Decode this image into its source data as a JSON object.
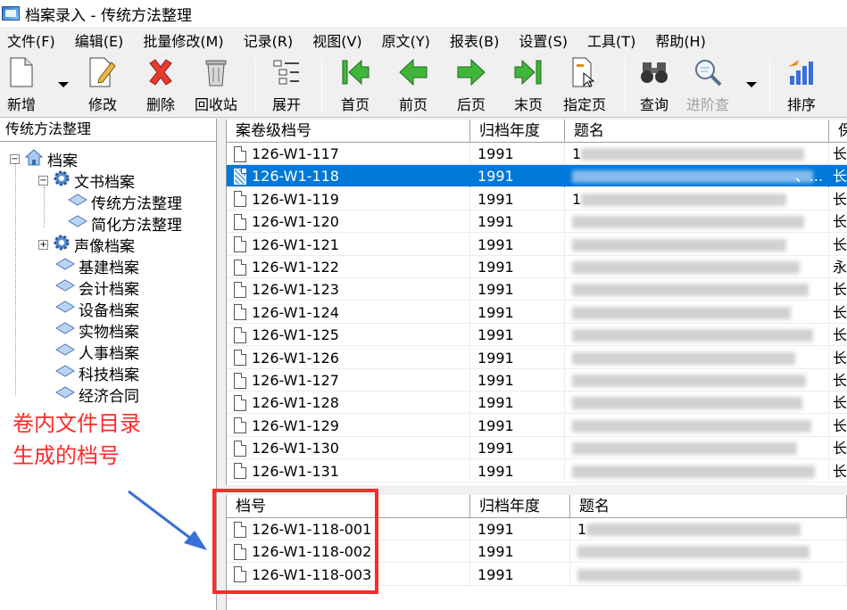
{
  "window": {
    "title": "档案录入 - 传统方法整理"
  },
  "menu": [
    "文件(F)",
    "编辑(E)",
    "批量修改(M)",
    "记录(R)",
    "视图(V)",
    "原文(Y)",
    "报表(B)",
    "设置(S)",
    "工具(T)",
    "帮助(H)"
  ],
  "toolbar": {
    "new": "新增",
    "edit": "修改",
    "delete": "删除",
    "recycle": "回收站",
    "expand": "展开",
    "first": "首页",
    "prev": "前页",
    "next": "后页",
    "last": "末页",
    "goto": "指定页",
    "query": "查询",
    "advanced_query": "进阶查",
    "sort": "排序"
  },
  "tree": {
    "header": "传统方法整理",
    "root": "档案",
    "items": [
      {
        "label": "文书档案"
      },
      {
        "label": "传统方法整理"
      },
      {
        "label": "简化方法整理"
      },
      {
        "label": "声像档案"
      },
      {
        "label": "基建档案"
      },
      {
        "label": "会计档案"
      },
      {
        "label": "设备档案"
      },
      {
        "label": "实物档案"
      },
      {
        "label": "人事档案"
      },
      {
        "label": "科技档案"
      },
      {
        "label": "经济合同"
      }
    ]
  },
  "annotation": {
    "line1": "卷内文件目录",
    "line2": "生成的档号"
  },
  "upper_grid": {
    "columns": [
      "案卷级档号",
      "归档年度",
      "题名",
      "保"
    ],
    "rows": [
      {
        "code": "126-W1-117",
        "year": "1991",
        "title_prefix": "1",
        "retention": "长"
      },
      {
        "code": "126-W1-118",
        "year": "1991",
        "title_prefix": "",
        "title_suffix": "、...",
        "retention": "长"
      },
      {
        "code": "126-W1-119",
        "year": "1991",
        "title_prefix": "1",
        "retention": "长"
      },
      {
        "code": "126-W1-120",
        "year": "1991",
        "title_prefix": "",
        "retention": "长"
      },
      {
        "code": "126-W1-121",
        "year": "1991",
        "title_prefix": "",
        "retention": "长"
      },
      {
        "code": "126-W1-122",
        "year": "1991",
        "title_prefix": "",
        "retention": "永"
      },
      {
        "code": "126-W1-123",
        "year": "1991",
        "title_prefix": "",
        "retention": "长"
      },
      {
        "code": "126-W1-124",
        "year": "1991",
        "title_prefix": "",
        "retention": "长"
      },
      {
        "code": "126-W1-125",
        "year": "1991",
        "title_prefix": "",
        "retention": "长"
      },
      {
        "code": "126-W1-126",
        "year": "1991",
        "title_prefix": "",
        "retention": "长"
      },
      {
        "code": "126-W1-127",
        "year": "1991",
        "title_prefix": "",
        "retention": "长"
      },
      {
        "code": "126-W1-128",
        "year": "1991",
        "title_prefix": "",
        "retention": "长"
      },
      {
        "code": "126-W1-129",
        "year": "1991",
        "title_prefix": "",
        "retention": "长"
      },
      {
        "code": "126-W1-130",
        "year": "1991",
        "title_prefix": "",
        "retention": "长"
      },
      {
        "code": "126-W1-131",
        "year": "1991",
        "title_prefix": "",
        "retention": "长"
      }
    ]
  },
  "lower_grid": {
    "columns": [
      "档号",
      "归档年度",
      "题名"
    ],
    "rows": [
      {
        "code": "126-W1-118-001",
        "year": "1991",
        "title_prefix": "1"
      },
      {
        "code": "126-W1-118-002",
        "year": "1991",
        "title_prefix": ""
      },
      {
        "code": "126-W1-118-003",
        "year": "1991",
        "title_prefix": ""
      }
    ]
  },
  "colors": {
    "selection": "#0078d7",
    "annotation": "#ff2b2b",
    "arrow": "#3a6fd8"
  }
}
